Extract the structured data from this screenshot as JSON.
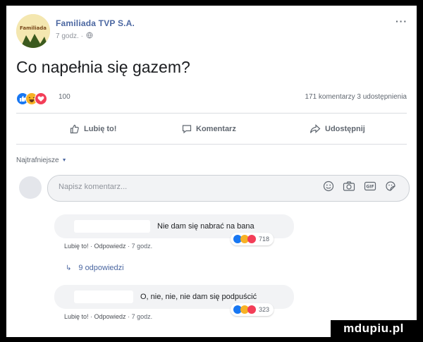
{
  "post": {
    "page_name": "Familiada TVP S.A.",
    "time": "7 godz. ·",
    "audience_icon": "globe-icon",
    "more_label": "···",
    "text": "Co napełnia się gazem?",
    "reaction_count": "100",
    "comments_shares": "171 komentarzy  3 udostępnienia",
    "reaction_types": [
      "like",
      "haha",
      "love"
    ]
  },
  "actions": {
    "like": "Lubię to!",
    "comment": "Komentarz",
    "share": "Udostępnij"
  },
  "comments_section": {
    "sort_label": "Najtrafniejsze",
    "input_placeholder": "Napisz komentarz...",
    "input_icons": [
      "emoji-icon",
      "camera-icon",
      "gif-icon",
      "sticker-icon"
    ]
  },
  "comments": [
    {
      "text": "Nie dam się nabrać na bana",
      "reaction_count": "718",
      "like": "Lubię to!",
      "reply": "Odpowiedz",
      "time": "7 godz."
    },
    {
      "text": "O, nie, nie, nie dam się podpuścić",
      "reaction_count": "323",
      "like": "Lubię to!",
      "reply": "Odpowiedz",
      "time": "7 godz."
    }
  ],
  "replies_link": "9 odpowiedzi",
  "watermark": "mdupiu.pl",
  "colors": {
    "accent": "#4b67a1",
    "like_blue": "#1877f2",
    "haha_yellow": "#f7b125",
    "love_red": "#f33e58"
  }
}
